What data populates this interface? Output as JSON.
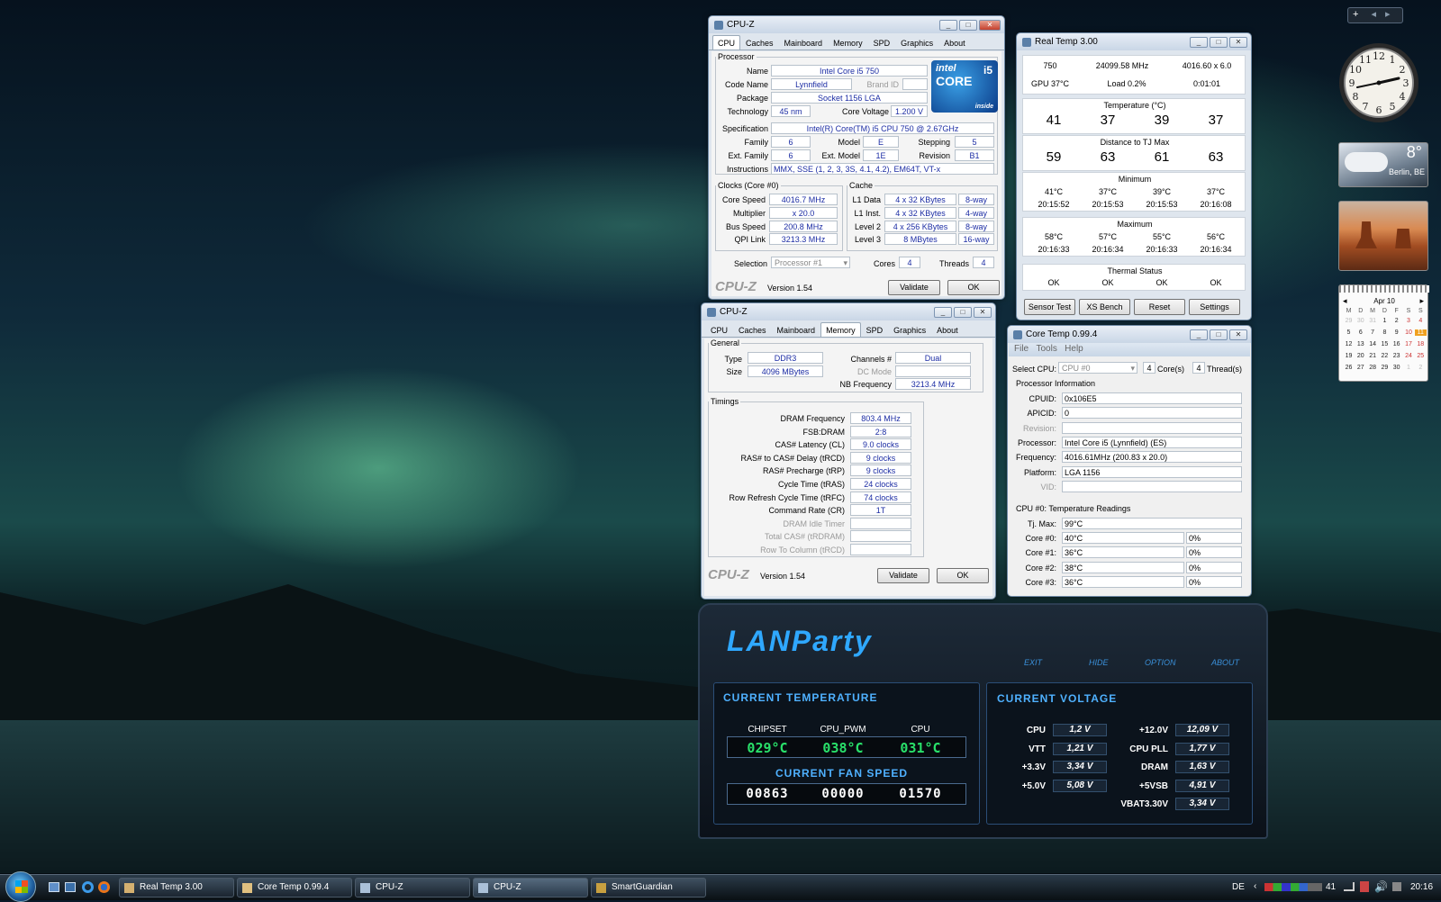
{
  "cpuz1": {
    "title": "CPU-Z",
    "tabs": [
      "CPU",
      "Caches",
      "Mainboard",
      "Memory",
      "SPD",
      "Graphics",
      "About"
    ],
    "proc_legend": "Processor",
    "name_l": "Name",
    "name": "Intel Core i5 750",
    "code_l": "Code Name",
    "code": "Lynnfield",
    "brand_l": "Brand ID",
    "pkg_l": "Package",
    "pkg": "Socket 1156 LGA",
    "tech_l": "Technology",
    "tech": "45 nm",
    "cv_l": "Core Voltage",
    "cv": "1.200 V",
    "spec_l": "Specification",
    "spec": "Intel(R) Core(TM) i5 CPU      750  @ 2.67GHz",
    "fam_l": "Family",
    "fam": "6",
    "mod_l": "Model",
    "mod": "E",
    "step_l": "Stepping",
    "step": "5",
    "efam_l": "Ext. Family",
    "efam": "6",
    "emod_l": "Ext. Model",
    "emod": "1E",
    "rev_l": "Revision",
    "rev": "B1",
    "instr_l": "Instructions",
    "instr": "MMX, SSE (1, 2, 3, 3S, 4.1, 4.2), EM64T, VT-x",
    "clk_legend": "Clocks (Core #0)",
    "cs_l": "Core Speed",
    "cs": "4016.7 MHz",
    "mul_l": "Multiplier",
    "mul": "x 20.0",
    "bus_l": "Bus Speed",
    "bus": "200.8 MHz",
    "qpi_l": "QPI Link",
    "qpi": "3213.3 MHz",
    "cache_legend": "Cache",
    "l1d_l": "L1 Data",
    "l1d": "4 x 32 KBytes",
    "l1d_w": "8-way",
    "l1i_l": "L1 Inst.",
    "l1i": "4 x 32 KBytes",
    "l1i_w": "4-way",
    "l2_l": "Level 2",
    "l2": "4 x 256 KBytes",
    "l2_w": "8-way",
    "l3_l": "Level 3",
    "l3": "8 MBytes",
    "l3_w": "16-way",
    "sel_l": "Selection",
    "sel": "Processor #1",
    "cores_l": "Cores",
    "cores": "4",
    "thr_l": "Threads",
    "thr": "4",
    "logo": "CPU-Z",
    "ver": "Version 1.54",
    "validate": "Validate",
    "ok": "OK",
    "intel_a": "intel",
    "intel_b": "CORE",
    "intel_c": "i5",
    "intel_d": "inside"
  },
  "cpuz2": {
    "title": "CPU-Z",
    "tabs": [
      "CPU",
      "Caches",
      "Mainboard",
      "Memory",
      "SPD",
      "Graphics",
      "About"
    ],
    "gen_legend": "General",
    "type_l": "Type",
    "type": "DDR3",
    "size_l": "Size",
    "size": "4096 MBytes",
    "ch_l": "Channels #",
    "ch": "Dual",
    "dc_l": "DC Mode",
    "nb_l": "NB Frequency",
    "nb": "3213.4 MHz",
    "tim_legend": "Timings",
    "rows": [
      [
        "DRAM Frequency",
        "803.4 MHz"
      ],
      [
        "FSB:DRAM",
        "2:8"
      ],
      [
        "CAS# Latency (CL)",
        "9.0 clocks"
      ],
      [
        "RAS# to CAS# Delay (tRCD)",
        "9 clocks"
      ],
      [
        "RAS# Precharge (tRP)",
        "9 clocks"
      ],
      [
        "Cycle Time (tRAS)",
        "24 clocks"
      ],
      [
        "Row Refresh Cycle Time (tRFC)",
        "74 clocks"
      ],
      [
        "Command Rate (CR)",
        "1T"
      ],
      [
        "DRAM Idle Timer",
        ""
      ],
      [
        "Total CAS# (tRDRAM)",
        ""
      ],
      [
        "Row To Column (tRCD)",
        ""
      ]
    ],
    "logo": "CPU-Z",
    "ver": "Version 1.54",
    "validate": "Validate",
    "ok": "OK"
  },
  "rt": {
    "title": "Real Temp 3.00",
    "a": "750",
    "b": "24099.58 MHz",
    "c": "4016.60 x 6.0",
    "gpu": "GPU  37°C",
    "load": "Load  0.2%",
    "time": "0:01:01",
    "temp_h": "Temperature (°C)",
    "temps": [
      "41",
      "37",
      "39",
      "37"
    ],
    "dist_h": "Distance to TJ Max",
    "dist": [
      "59",
      "63",
      "61",
      "63"
    ],
    "min_h": "Minimum",
    "min": [
      "41°C",
      "37°C",
      "39°C",
      "37°C"
    ],
    "min_t": [
      "20:15:52",
      "20:15:53",
      "20:15:53",
      "20:16:08"
    ],
    "max_h": "Maximum",
    "max": [
      "58°C",
      "57°C",
      "55°C",
      "56°C"
    ],
    "max_t": [
      "20:16:33",
      "20:16:34",
      "20:16:33",
      "20:16:34"
    ],
    "th_h": "Thermal Status",
    "th": [
      "OK",
      "OK",
      "OK",
      "OK"
    ],
    "btns": [
      "Sensor Test",
      "XS Bench",
      "Reset",
      "Settings"
    ]
  },
  "ct": {
    "title": "Core Temp 0.99.4",
    "menu": [
      "File",
      "Tools",
      "Help"
    ],
    "sel_l": "Select CPU:",
    "sel": "CPU #0",
    "cores": "4",
    "cores_l": "Core(s)",
    "thr": "4",
    "thr_l": "Thread(s)",
    "pi_h": "Processor Information",
    "cpuid_l": "CPUID:",
    "cpuid": "0x106E5",
    "apic_l": "APICID:",
    "apic": "0",
    "rev_l": "Revision:",
    "proc_l": "Processor:",
    "proc": "Intel Core i5 (Lynnfield) (ES)",
    "freq_l": "Frequency:",
    "freq": "4016.61MHz (200.83 x 20.0)",
    "plat_l": "Platform:",
    "plat": "LGA 1156",
    "vid_l": "VID:",
    "tr_h": "CPU #0: Temperature Readings",
    "tj_l": "Tj. Max:",
    "tj": "99°C",
    "cores_rows": [
      [
        "Core #0:",
        "40°C",
        "0%"
      ],
      [
        "Core #1:",
        "36°C",
        "0%"
      ],
      [
        "Core #2:",
        "38°C",
        "0%"
      ],
      [
        "Core #3:",
        "36°C",
        "0%"
      ]
    ]
  },
  "lan": {
    "title": "LANParty",
    "menu": [
      "EXIT",
      "HIDE",
      "OPTION",
      "ABOUT"
    ],
    "ct_h": "CURRENT TEMPERATURE",
    "labels": [
      "CHIPSET",
      "CPU_PWM",
      "CPU"
    ],
    "temps": [
      "029°C",
      "038°C",
      "031°C"
    ],
    "fan_h": "CURRENT FAN SPEED",
    "fans": [
      "00863",
      "00000",
      "01570"
    ],
    "cv_h": "CURRENT VOLTAGE",
    "left": [
      [
        "CPU",
        "1,2 V"
      ],
      [
        "VTT",
        "1,21 V"
      ],
      [
        "+3.3V",
        "3,34 V"
      ],
      [
        "+5.0V",
        "5,08 V"
      ]
    ],
    "right": [
      [
        "+12.0V",
        "12,09 V"
      ],
      [
        "CPU PLL",
        "1,77 V"
      ],
      [
        "DRAM",
        "1,63 V"
      ],
      [
        "+5VSB",
        "4,91 V"
      ],
      [
        "VBAT3.30V",
        "3,34 V"
      ]
    ]
  },
  "gadgets": {
    "weather_temp": "8°",
    "weather_city": "Berlin, BE",
    "cal_month": "Apr 10",
    "cal_days": [
      "M",
      "D",
      "M",
      "D",
      "F",
      "S",
      "S"
    ],
    "cal": [
      [
        "29",
        "30",
        "31",
        "1",
        "2",
        "3",
        "4"
      ],
      [
        "5",
        "6",
        "7",
        "8",
        "9",
        "10",
        "11"
      ],
      [
        "12",
        "13",
        "14",
        "15",
        "16",
        "17",
        "18"
      ],
      [
        "19",
        "20",
        "21",
        "22",
        "23",
        "24",
        "25"
      ],
      [
        "26",
        "27",
        "28",
        "29",
        "30",
        "1",
        "2"
      ]
    ],
    "clock_nums": [
      "12",
      "1",
      "2",
      "3",
      "4",
      "5",
      "6",
      "7",
      "8",
      "9",
      "10",
      "11"
    ]
  },
  "taskbar": {
    "items": [
      "Real Temp 3.00",
      "Core Temp 0.99.4",
      "CPU-Z",
      "CPU-Z",
      "SmartGuardian"
    ],
    "lang": "DE",
    "time": "20:16",
    "tray_num": "41"
  }
}
